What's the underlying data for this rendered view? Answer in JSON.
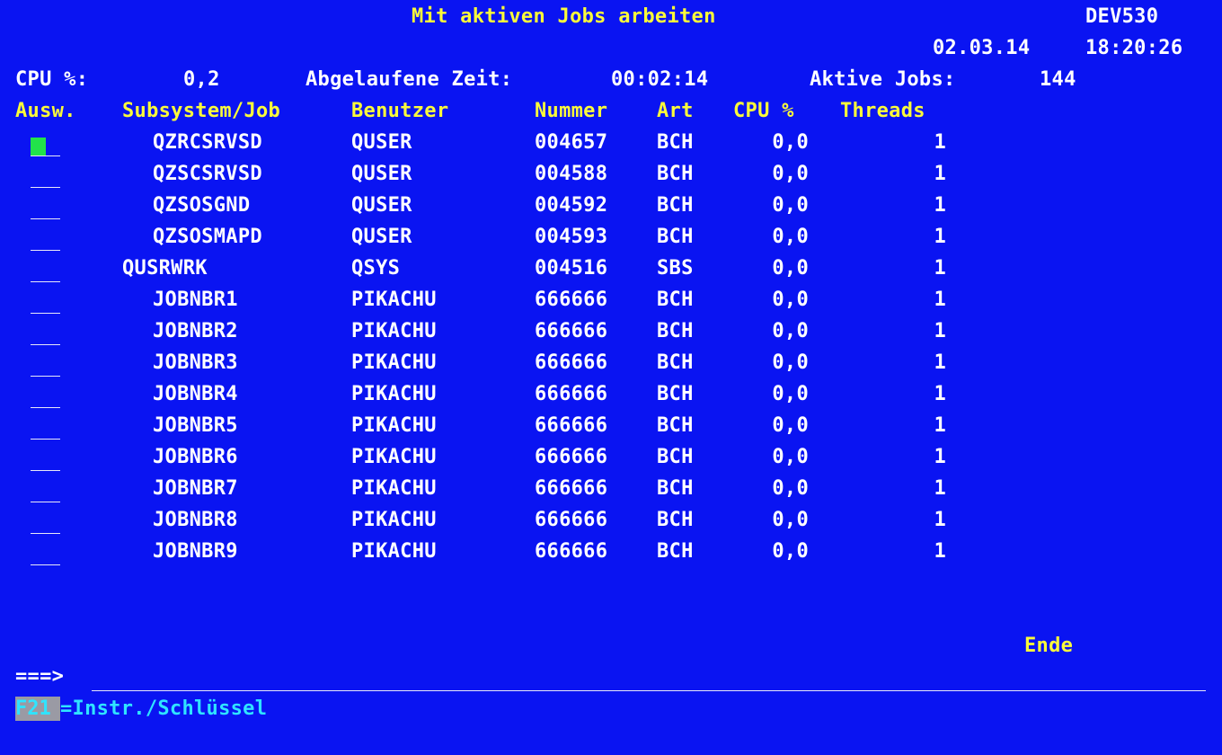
{
  "header": {
    "title": "Mit aktiven Jobs arbeiten",
    "system": "DEV530",
    "date": "02.03.14",
    "time": "18:20:26"
  },
  "stats": {
    "cpu_label": "CPU %:",
    "cpu_value": "0,2",
    "elapsed_label": "Abgelaufene Zeit:",
    "elapsed_value": "00:02:14",
    "active_label": "Aktive Jobs:",
    "active_value": "144"
  },
  "columns": {
    "option": "Ausw.",
    "job": "Subsystem/Job",
    "user": "Benutzer",
    "number": "Nummer",
    "type": "Art",
    "cpu": "CPU %",
    "threads": "Threads"
  },
  "rows": [
    {
      "job": "QZRCSRVSD",
      "user": "QUSER",
      "number": "004657",
      "type": "BCH",
      "cpu": "0,0",
      "threads": "1"
    },
    {
      "job": "QZSCSRVSD",
      "user": "QUSER",
      "number": "004588",
      "type": "BCH",
      "cpu": "0,0",
      "threads": "1"
    },
    {
      "job": "QZSOSGND",
      "user": "QUSER",
      "number": "004592",
      "type": "BCH",
      "cpu": "0,0",
      "threads": "1"
    },
    {
      "job": "QZSOSMAPD",
      "user": "QUSER",
      "number": "004593",
      "type": "BCH",
      "cpu": "0,0",
      "threads": "1"
    },
    {
      "job": "QUSRWRK",
      "user": "QSYS",
      "number": "004516",
      "type": "SBS",
      "cpu": "0,0",
      "threads": "1"
    },
    {
      "job": "JOBNBR1",
      "user": "PIKACHU",
      "number": "666666",
      "type": "BCH",
      "cpu": "0,0",
      "threads": "1"
    },
    {
      "job": "JOBNBR2",
      "user": "PIKACHU",
      "number": "666666",
      "type": "BCH",
      "cpu": "0,0",
      "threads": "1"
    },
    {
      "job": "JOBNBR3",
      "user": "PIKACHU",
      "number": "666666",
      "type": "BCH",
      "cpu": "0,0",
      "threads": "1"
    },
    {
      "job": "JOBNBR4",
      "user": "PIKACHU",
      "number": "666666",
      "type": "BCH",
      "cpu": "0,0",
      "threads": "1"
    },
    {
      "job": "JOBNBR5",
      "user": "PIKACHU",
      "number": "666666",
      "type": "BCH",
      "cpu": "0,0",
      "threads": "1"
    },
    {
      "job": "JOBNBR6",
      "user": "PIKACHU",
      "number": "666666",
      "type": "BCH",
      "cpu": "0,0",
      "threads": "1"
    },
    {
      "job": "JOBNBR7",
      "user": "PIKACHU",
      "number": "666666",
      "type": "BCH",
      "cpu": "0,0",
      "threads": "1"
    },
    {
      "job": "JOBNBR8",
      "user": "PIKACHU",
      "number": "666666",
      "type": "BCH",
      "cpu": "0,0",
      "threads": "1"
    },
    {
      "job": "JOBNBR9",
      "user": "PIKACHU",
      "number": "666666",
      "type": "BCH",
      "cpu": "0,0",
      "threads": "1"
    }
  ],
  "status": {
    "end_label": "Ende"
  },
  "command": {
    "prompt": "===>",
    "value": ""
  },
  "function_keys": {
    "key": "F21",
    "label": "=Instr./Schlüssel"
  },
  "colors": {
    "background": "#0a14f2",
    "yellow": "#fbfb3a",
    "white": "#ffffff",
    "cyan": "#2fe4ff",
    "cursor": "#22e24a"
  }
}
